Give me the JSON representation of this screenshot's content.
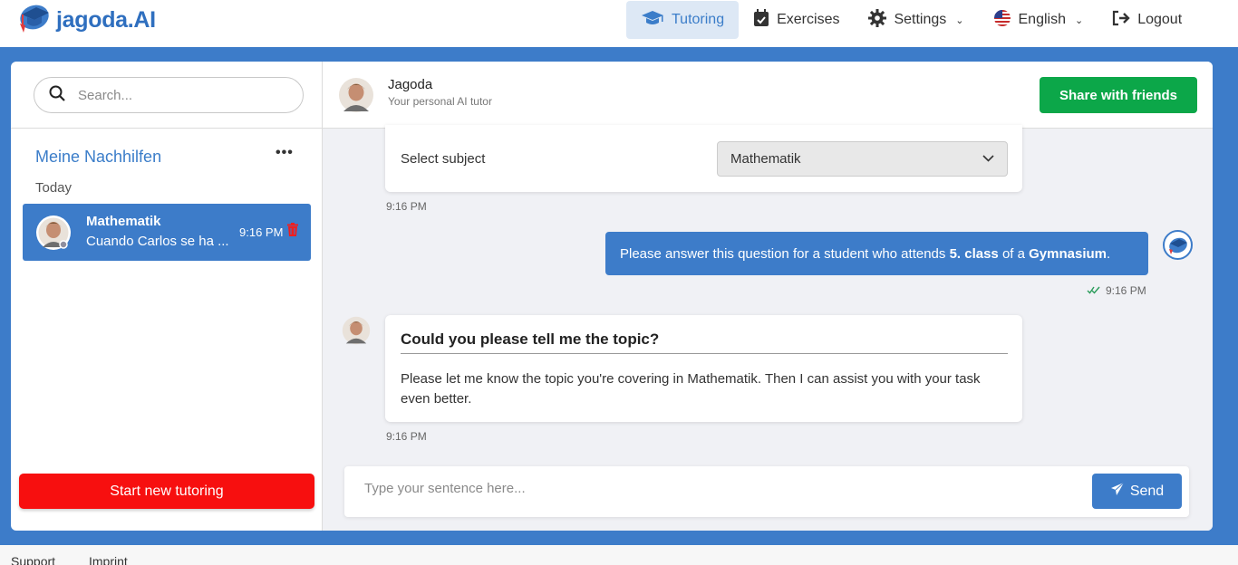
{
  "brand": {
    "name": "jagoda",
    "suffix": ".AI"
  },
  "nav": {
    "tutoring": "Tutoring",
    "exercises": "Exercises",
    "settings": "Settings",
    "language": "English",
    "logout": "Logout"
  },
  "sidebar": {
    "search_placeholder": "Search...",
    "section_title": "Meine Nachhilfen",
    "more": "•••",
    "group_today": "Today",
    "chats": [
      {
        "title": "Mathematik",
        "preview": "Cuando Carlos se ha ...",
        "time": "9:16 PM"
      }
    ],
    "new_button": "Start new tutoring"
  },
  "chat": {
    "tutor_name": "Jagoda",
    "tutor_subtitle": "Your personal AI tutor",
    "share_button": "Share with friends",
    "subject_label": "Select subject",
    "subject_value": "Mathematik",
    "time1": "9:16 PM",
    "user_message": {
      "prefix": "Please answer this question for a student who attends ",
      "class": "5. class",
      "middle": " of a ",
      "school": "Gymnasium",
      "suffix": "."
    },
    "time2": "9:16 PM",
    "bot_question": "Could you please tell me the topic?",
    "bot_answer": "Please let me know the topic you're covering in Mathematik. Then I can assist you with your task even better.",
    "time3": "9:16 PM",
    "input_placeholder": "Type your sentence here...",
    "send_button": "Send"
  },
  "footer": {
    "support": "Support",
    "imprint": "Imprint"
  },
  "colors": {
    "primary": "#3d7cc9",
    "share": "#0ca749",
    "new": "#f70f0f"
  }
}
